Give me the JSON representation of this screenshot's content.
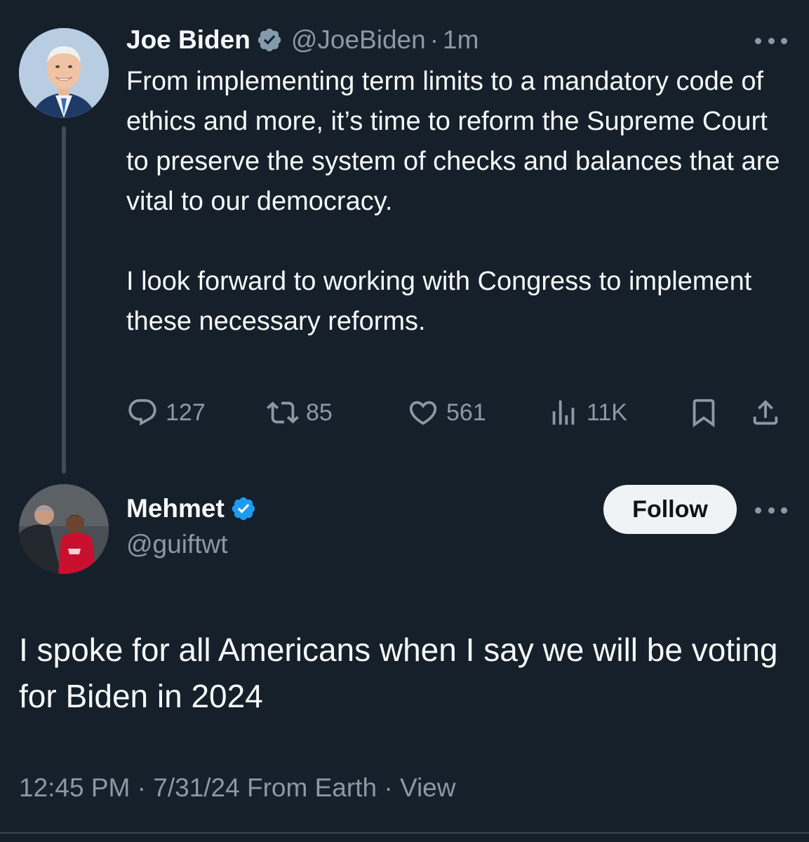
{
  "parent_tweet": {
    "author_name": "Joe Biden",
    "handle": "@JoeBiden",
    "separator": "·",
    "time": "1m",
    "badge": "gray-verified-badge-icon",
    "text_paragraph_1": "From implementing term limits to a mandatory code of ethics and more, it’s time to reform the Supreme Court to preserve the system of checks and balances that are vital to our democracy.",
    "text_paragraph_2": "I look forward to working with Congress to implement these necessary reforms.",
    "actions": {
      "replies": "127",
      "retweets": "85",
      "likes": "561",
      "views": "11K"
    }
  },
  "reply_tweet": {
    "author_name": "Mehmet",
    "handle": "@guiftwt",
    "badge": "blue-verified-badge-icon",
    "follow_label": "Follow",
    "text": "I spoke for all Americans when I say we will be voting for Biden in 2024",
    "meta": {
      "time": "12:45 PM",
      "separator_1": "·",
      "date": "7/31/24",
      "source": "From Earth",
      "separator_2": "·",
      "view_link": "View"
    }
  },
  "colors": {
    "background": "#15202b",
    "primary_text": "#f7f9f9",
    "secondary_text": "#8b98a5",
    "verified_blue": "#1d9bf0",
    "verified_gray": "#829aab",
    "follow_button_bg": "#eff3f4"
  }
}
